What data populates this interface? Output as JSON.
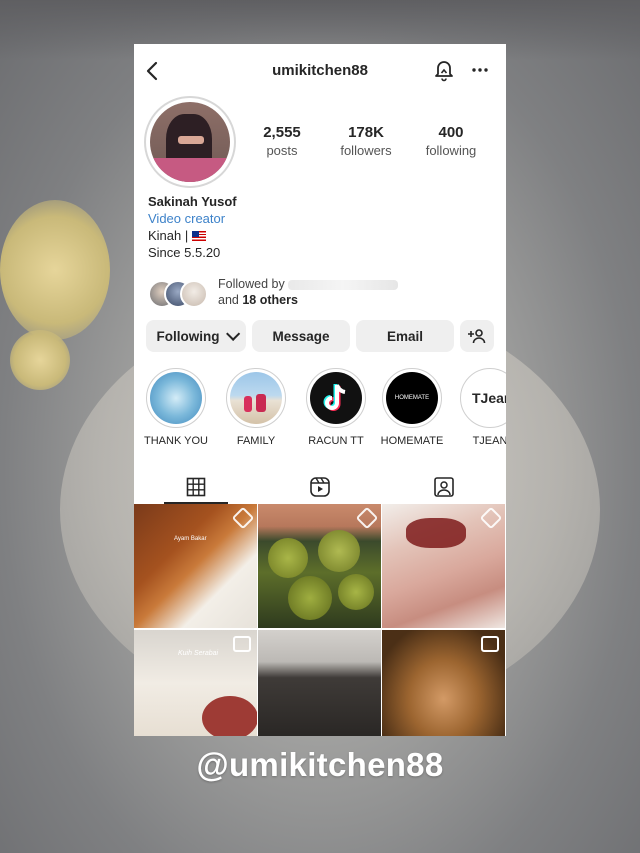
{
  "profile": {
    "username": "umikitchen88",
    "name": "Sakinah Yusof",
    "role": "Video creator",
    "bio_line1": "Kinah |",
    "bio_line2": "Since 5.5.20"
  },
  "stats": [
    {
      "value": "2,555",
      "label": "posts"
    },
    {
      "value": "178K",
      "label": "followers"
    },
    {
      "value": "400",
      "label": "following"
    }
  ],
  "followed_by": {
    "prefix": "Followed by",
    "suffix_and": "and",
    "others": "18 others"
  },
  "buttons": {
    "following": "Following",
    "message": "Message",
    "email": "Email"
  },
  "highlights": [
    {
      "label": "THANK YOU"
    },
    {
      "label": "FAMILY"
    },
    {
      "label": "RACUN TT"
    },
    {
      "label": "HOMEMATE",
      "inner_text": "HOMEMATE"
    },
    {
      "label": "TJEAN",
      "inner_text": "TJean"
    }
  ],
  "grid_posts": [
    {
      "overlay_text": "Ayam Bakar"
    },
    {
      "overlay_text": ""
    },
    {
      "overlay_text": ""
    },
    {
      "overlay_text": "Kuih Serabai"
    },
    {
      "overlay_text": ""
    },
    {
      "overlay_text": ""
    }
  ],
  "caption": "@umikitchen88",
  "icons": [
    "back-icon",
    "bell-icon",
    "more-icon",
    "add-person-icon",
    "grid-icon",
    "reels-icon",
    "tagged-icon"
  ],
  "colors": {
    "link": "#3d82c9",
    "button_bg": "#efefef",
    "caption": "#ffffff"
  }
}
